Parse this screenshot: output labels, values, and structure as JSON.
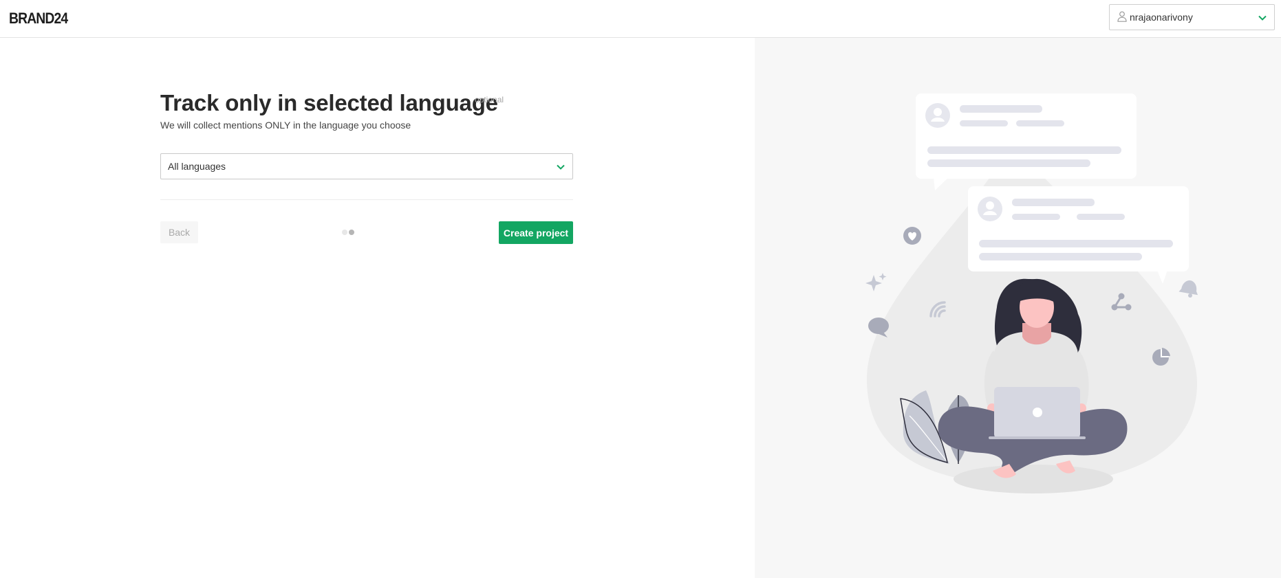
{
  "header": {
    "logo_text": "BRAND24",
    "user": {
      "name": "nrajaonarivony",
      "user_icon": "user-icon",
      "chevron_icon": "chevron-down-icon"
    }
  },
  "form": {
    "title": "Track only in selected language",
    "optional_label": "optional",
    "subtitle": "We will collect mentions ONLY in the language you choose",
    "language_select": {
      "value": "All languages",
      "chevron_icon": "chevron-down-icon"
    },
    "back_label": "Back",
    "create_label": "Create project",
    "step_dots": {
      "total": 2,
      "current": 2
    }
  },
  "colors": {
    "accent_green": "#13a662",
    "panel_background": "#f7f7f7"
  },
  "illustration": {
    "subject": "woman-with-laptop-illustration"
  }
}
